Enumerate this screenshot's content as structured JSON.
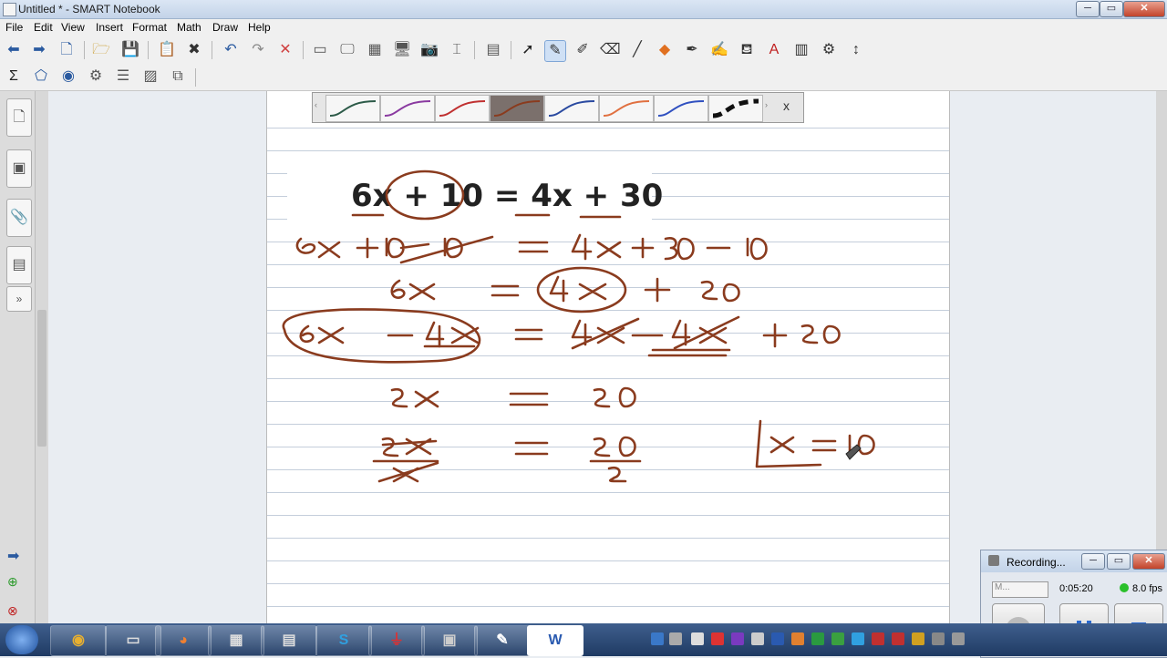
{
  "window": {
    "title": "Untitled * - SMART Notebook",
    "min_label": "─",
    "max_label": "▭",
    "close_label": "✕"
  },
  "menu": [
    "File",
    "Edit",
    "View",
    "Insert",
    "Format",
    "Math",
    "Draw",
    "Help"
  ],
  "toolbar": {
    "pen_bar_close": "x"
  },
  "canvas": {
    "typed_equation": "6x + 10 = 4x + 30",
    "ink_color": "#8a3b1e",
    "handwritten_lines": [
      "6x + 10 − 10 = 4x + 30 − 10",
      "6x = 4x + 20",
      "6x − 4x = 4x − 4x + 20",
      "2x = 20",
      "2x/x = 20/2",
      "x = 10"
    ]
  },
  "recording": {
    "title": "Recording...",
    "time": "0:05:20",
    "fps": "8.0 fps",
    "mode_select": "M..."
  },
  "taskbar": {
    "apps": [
      "chrome-icon",
      "file-icon",
      "firefox-icon",
      "calculator-icon",
      "calc2-icon",
      "skype-icon",
      "acrobat-icon",
      "folder-icon",
      "notebook-icon",
      "word-icon"
    ]
  }
}
